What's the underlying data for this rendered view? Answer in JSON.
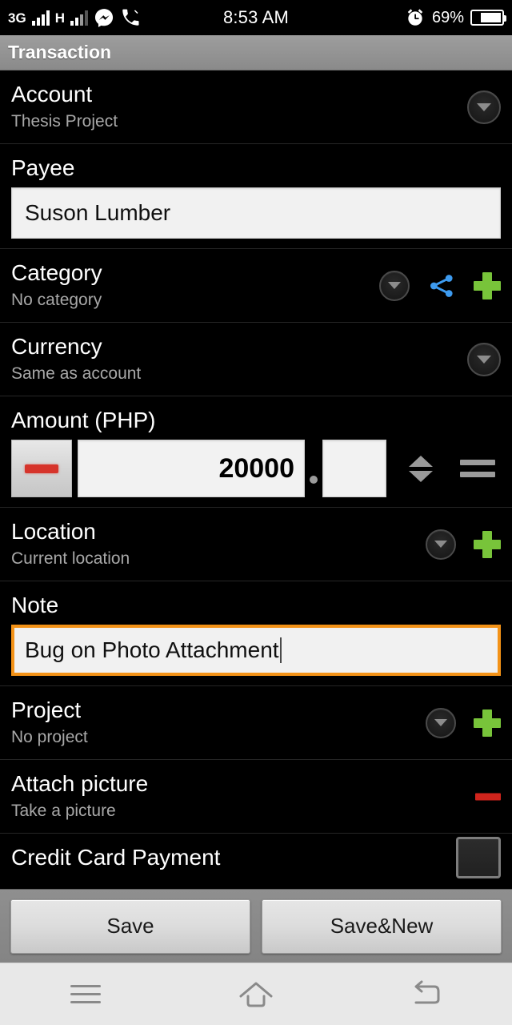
{
  "status_bar": {
    "network_type": "3G",
    "network_type_2": "H",
    "messenger_icon": "messenger-icon",
    "call_icon": "missed-call-icon",
    "time": "8:53 AM",
    "alarm_icon": "alarm-clock-icon",
    "battery_percent": "69%",
    "battery_icon": "battery-icon"
  },
  "title_bar": {
    "title": "Transaction"
  },
  "form": {
    "account": {
      "label": "Account",
      "value": "Thesis Project",
      "dropdown_icon": "chevron-down-icon"
    },
    "payee": {
      "label": "Payee",
      "value": "Suson Lumber"
    },
    "category": {
      "label": "Category",
      "value": "No category",
      "dropdown_icon": "chevron-down-icon",
      "share_icon": "share-icon",
      "add_icon": "plus-icon"
    },
    "currency": {
      "label": "Currency",
      "value": "Same as account",
      "dropdown_icon": "chevron-down-icon"
    },
    "amount": {
      "label": "Amount (PHP)",
      "currency_code": "PHP",
      "minus_icon": "minus-icon",
      "integer_value": "20000",
      "decimal_separator": ".",
      "decimal_value": "",
      "stepper_icon": "up-down-arrows-icon",
      "equals_icon": "equals-icon"
    },
    "location": {
      "label": "Location",
      "value": "Current location",
      "dropdown_icon": "chevron-down-icon",
      "add_icon": "plus-icon"
    },
    "note": {
      "label": "Note",
      "value": "Bug on Photo Attachment",
      "focused": true
    },
    "project": {
      "label": "Project",
      "value": "No project",
      "dropdown_icon": "chevron-down-icon",
      "add_icon": "plus-icon"
    },
    "attach_picture": {
      "label": "Attach picture",
      "value": "Take a picture",
      "remove_icon": "minus-icon"
    },
    "credit_card_payment": {
      "label": "Credit Card Payment",
      "checkbox_icon": "checkbox-unchecked-icon",
      "checked": false
    }
  },
  "button_bar": {
    "save_label": "Save",
    "save_new_label": "Save&New"
  },
  "nav_bar": {
    "menu_icon": "menu-icon",
    "home_icon": "home-icon",
    "back_icon": "back-icon"
  },
  "colors": {
    "accent_green": "#78c43a",
    "accent_blue": "#3d9bf0",
    "accent_red": "#d0241c",
    "focus_orange": "#f39217",
    "title_gray": "#949494",
    "background": "#000000"
  }
}
